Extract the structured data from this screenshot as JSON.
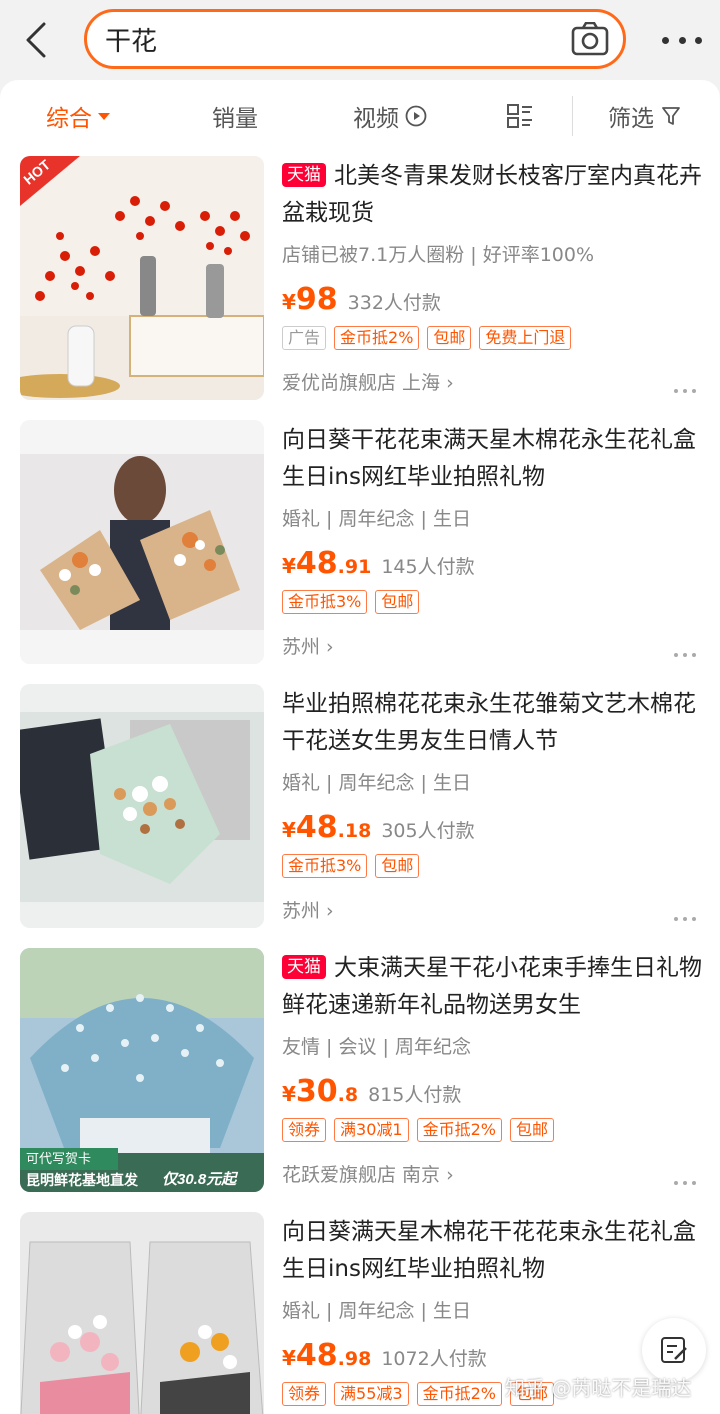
{
  "search": {
    "query": "干花"
  },
  "tabs": [
    {
      "label": "综合"
    },
    {
      "label": "销量"
    },
    {
      "label": "视频"
    },
    {
      "label": "筛选"
    }
  ],
  "products": [
    {
      "tmall": "天猫",
      "title": "北美冬青果发财长枝客厅室内真花卉盆栽现货",
      "tags": "店铺已被7.1万人圈粉 | 好评率100%",
      "currency": "¥",
      "price_int": "98",
      "price_dec": "",
      "sold": "332人付款",
      "badges": [
        "广告",
        "金币抵2%",
        "包邮",
        "免费上门退"
      ],
      "shop": "爱优尚旗舰店 上海 ›",
      "thumb_label": "HOT"
    },
    {
      "title": "向日葵干花花束满天星木棉花永生花礼盒生日ins网红毕业拍照礼物",
      "tags": "婚礼 | 周年纪念 | 生日",
      "currency": "¥",
      "price_int": "48",
      "price_dec": ".91",
      "sold": "145人付款",
      "badges": [
        "金币抵3%",
        "包邮"
      ],
      "shop": "苏州 ›"
    },
    {
      "title": "毕业拍照棉花花束永生花雏菊文艺木棉花干花送女生男友生日情人节",
      "tags": "婚礼 | 周年纪念 | 生日",
      "currency": "¥",
      "price_int": "48",
      "price_dec": ".18",
      "sold": "305人付款",
      "badges": [
        "金币抵3%",
        "包邮"
      ],
      "shop": "苏州 ›"
    },
    {
      "tmall": "天猫",
      "title": "大束满天星干花小花束手捧生日礼物鲜花速递新年礼品物送男女生",
      "tags": "友情 | 会议 | 周年纪念",
      "currency": "¥",
      "price_int": "30",
      "price_dec": ".8",
      "sold": "815人付款",
      "badges": [
        "领券",
        "满30减1",
        "金币抵2%",
        "包邮"
      ],
      "shop": "花跃爱旗舰店 南京 ›",
      "thumb_tag": "可代写贺卡",
      "thumb_banner": "昆明鲜花基地直发",
      "thumb_price": "仅30.8元起"
    },
    {
      "title": "向日葵满天星木棉花干花花束永生花礼盒生日ins网红毕业拍照礼物",
      "tags": "婚礼 | 周年纪念 | 生日",
      "currency": "¥",
      "price_int": "48",
      "price_dec": ".98",
      "sold": "1072人付款",
      "badges": [
        "领券",
        "满55减3",
        "金币抵2%",
        "包邮"
      ]
    }
  ],
  "watermark": "知乎 @芮哒不是瑞达"
}
